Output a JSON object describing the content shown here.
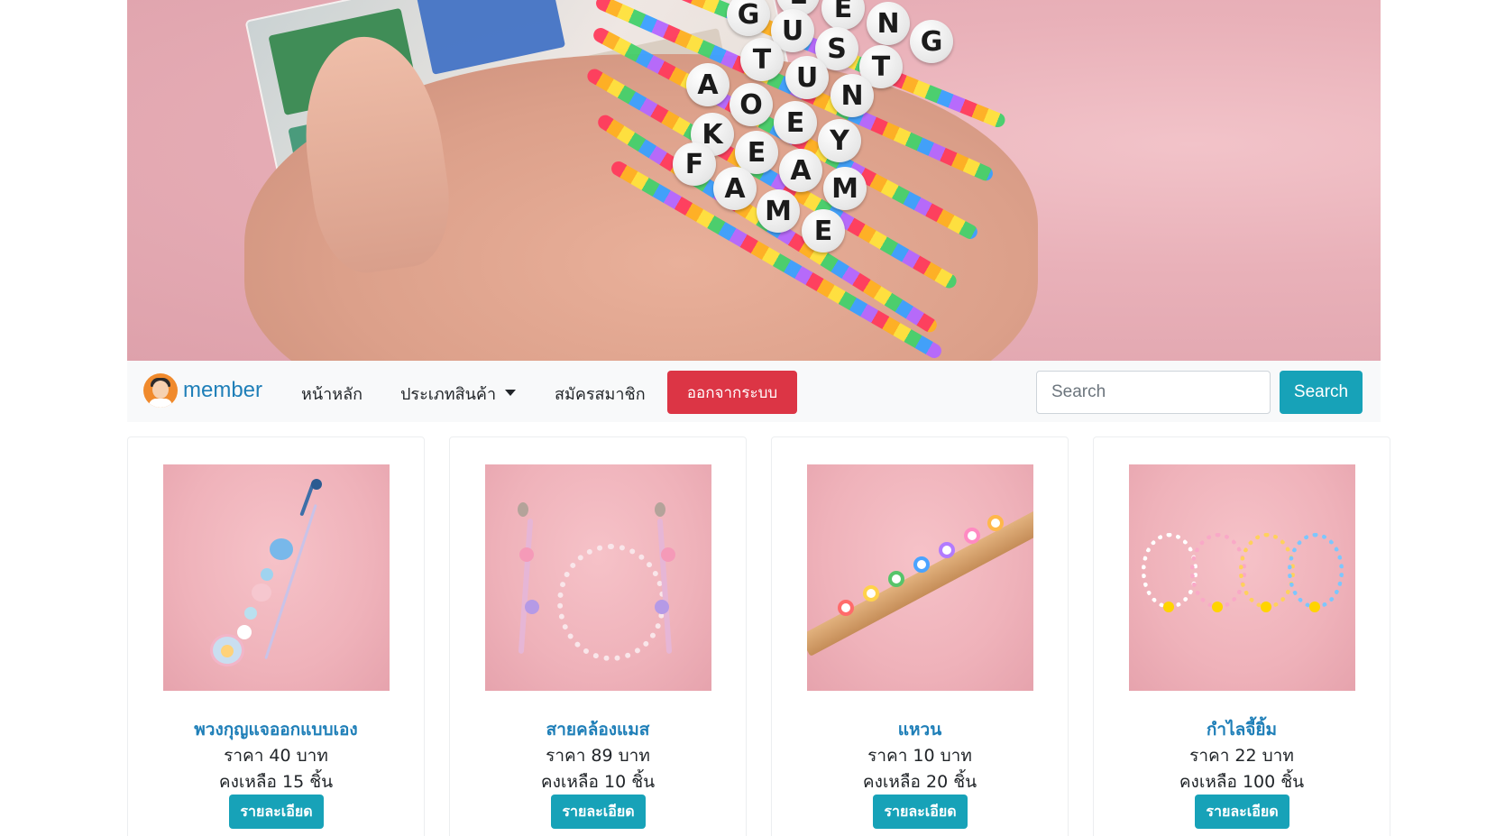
{
  "hero": {
    "image": "beaded-name-bracelets-photo",
    "bead_letters": [
      "L",
      "E",
      "N",
      "G",
      "G",
      "U",
      "S",
      "T",
      "T",
      "U",
      "N",
      "A",
      "O",
      "E",
      "Y",
      "K",
      "E",
      "A",
      "M",
      "F",
      "A",
      "M",
      "E"
    ]
  },
  "navbar": {
    "brand_label": "member",
    "avatar_icon": "user-avatar-icon",
    "links": {
      "home": "หน้าหลัก",
      "categories": "ประเภทสินค้า",
      "register": "สมัครสมาชิก"
    },
    "logout_label": "ออกจากระบบ",
    "search_placeholder": "Search",
    "search_button": "Search"
  },
  "colors": {
    "brand": "#1f7fb8",
    "info": "#17a2b8",
    "danger": "#dc3545",
    "navbar_bg": "#f8f9fa"
  },
  "products": [
    {
      "name": "พวงกุญแจออกแบบเอง",
      "price": "ราคา 40 บาท",
      "stock": "คงเหลือ 15 ชิ้น",
      "detail_label": "รายละเอียด",
      "image": "keychain"
    },
    {
      "name": "สายคล้องแมส",
      "price": "ราคา 89 บาท",
      "stock": "คงเหลือ 10 ชิ้น",
      "detail_label": "รายละเอียด",
      "image": "mask-strap"
    },
    {
      "name": "แหวน",
      "price": "ราคา 10 บาท",
      "stock": "คงเหลือ 20 ชิ้น",
      "detail_label": "รายละเอียด",
      "image": "rings"
    },
    {
      "name": "กำไลจี้ยิ้ม",
      "price": "ราคา 22 บาท",
      "stock": "คงเหลือ 100 ชิ้น",
      "detail_label": "รายละเอียด",
      "image": "smiley-bracelets"
    }
  ]
}
